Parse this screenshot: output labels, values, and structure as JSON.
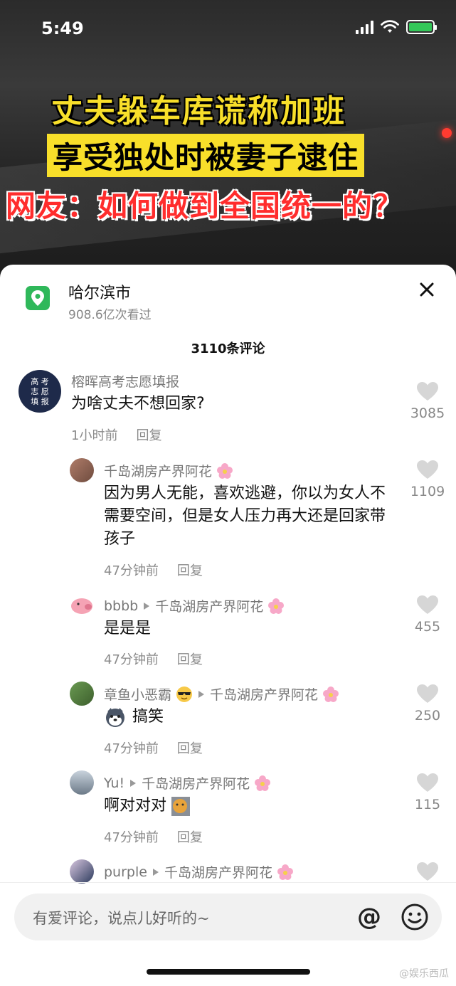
{
  "status": {
    "time": "5:49"
  },
  "video": {
    "caption_line1": "丈夫躲车库谎称加班",
    "caption_line2": "享受独处时被妻子逮住",
    "caption_line3": "网友：如何做到全国统一的？"
  },
  "location": {
    "title": "哈尔滨市",
    "views": "908.6亿次看过"
  },
  "comments_count": "3110条评论",
  "comments": [
    {
      "avatar_label": "高考志愿填报",
      "name": "榕晖高考志愿填报",
      "text": "为啥丈夫不想回家?",
      "time": "1小时前",
      "reply": "回复",
      "likes": "3085"
    },
    {
      "name": "千岛湖房产界阿花",
      "text": "因为男人无能，喜欢逃避，你以为女人不需要空间，但是女人压力再大还是回家带孩子",
      "time": "47分钟前",
      "reply": "回复",
      "likes": "1109"
    },
    {
      "name": "bbbb",
      "reply_to": "千岛湖房产界阿花",
      "text": "是是是",
      "time": "47分钟前",
      "reply": "回复",
      "likes": "455"
    },
    {
      "name": "章鱼小恶霸",
      "reply_to": "千岛湖房产界阿花",
      "text": "搞笑",
      "time": "47分钟前",
      "reply": "回复",
      "likes": "250"
    },
    {
      "name": "Yu!",
      "reply_to": "千岛湖房产界阿花",
      "text": "啊对对对",
      "time": "47分钟前",
      "reply": "回复",
      "likes": "115"
    },
    {
      "name": "purple",
      "reply_to": "千岛湖房产界阿花"
    }
  ],
  "input": {
    "placeholder": "有爱评论，说点儿好听的~",
    "at": "@"
  },
  "watermark": "@娱乐西瓜",
  "colors": {
    "accent_yellow": "#f8df2a",
    "accent_red": "#ff2d2d",
    "location_green": "#2fb85a"
  }
}
